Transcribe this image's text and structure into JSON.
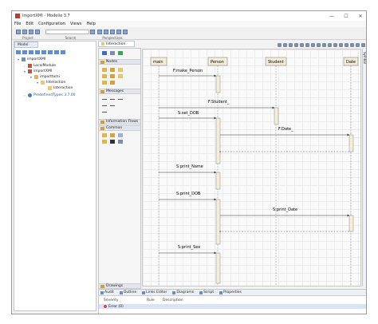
{
  "window": {
    "title": "importXMI - Modelio 3.7",
    "controls": [
      "—",
      "☐",
      "✕"
    ]
  },
  "menu": [
    "File",
    "Edit",
    "Configuration",
    "Views",
    "Help"
  ],
  "toolbar": {
    "groups": [
      "Project",
      "Search",
      "Perspectives"
    ]
  },
  "model_panel": {
    "tab_label": "Model",
    "tree": [
      {
        "label": "importXMI",
        "level": 0
      },
      {
        "label": "LocalModule",
        "level": 1
      },
      {
        "label": "importXMI",
        "level": 1
      },
      {
        "label": "importtxmi",
        "level": 2
      },
      {
        "label": "Interaction",
        "level": 3
      },
      {
        "label": "Interaction",
        "level": 4
      },
      {
        "label": "PredefinedTypes 3.7.00",
        "level": 0
      }
    ]
  },
  "diagram": {
    "tab_label": "Interaction",
    "palette_sections": [
      "Nodes",
      "Messages",
      "Information Flows",
      "Common"
    ],
    "drawings_label": "Drawings",
    "lifelines": [
      "main",
      "Person",
      "Student",
      "Date"
    ],
    "messages": [
      "F:make_Person",
      "F:Student_",
      "S:set_DOB",
      "F:Date_",
      "S:print_Name",
      "S:print_DOB",
      "S:print_Date",
      "S:print_Sex"
    ],
    "side_label": "Symbol"
  },
  "bottom_panel": {
    "tabs": [
      "Audit",
      "Outline",
      "Links Editor",
      "Diagrams",
      "Script",
      "Properties"
    ],
    "columns": [
      "Severity",
      "Rule",
      "Description"
    ],
    "row_severity": "Error (0)"
  },
  "colors": {
    "lifeline_head": "#f4edd8",
    "activation": "#f4edd8",
    "accent": "#5d8ed1"
  }
}
